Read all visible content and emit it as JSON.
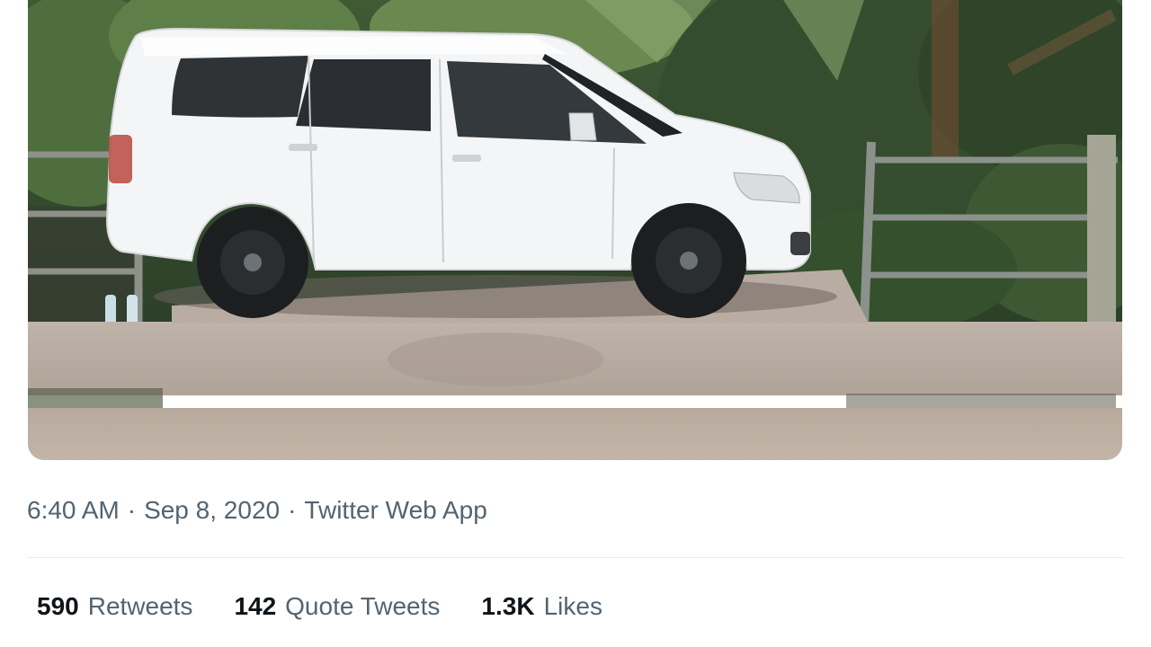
{
  "tweet": {
    "media": {
      "type": "video",
      "subject": "white-minivan-on-sidewalk"
    },
    "meta": {
      "time": "6:40 AM",
      "separator": "·",
      "date": "Sep 8, 2020",
      "source": "Twitter Web App"
    },
    "stats": {
      "retweets": {
        "count": "590",
        "label": "Retweets"
      },
      "quote_tweets": {
        "count": "142",
        "label": "Quote Tweets"
      },
      "likes": {
        "count": "1.3K",
        "label": "Likes"
      }
    }
  },
  "colors": {
    "secondary_text": "#536471",
    "primary_text": "#0f1419",
    "divider": "#e6ecf0"
  }
}
